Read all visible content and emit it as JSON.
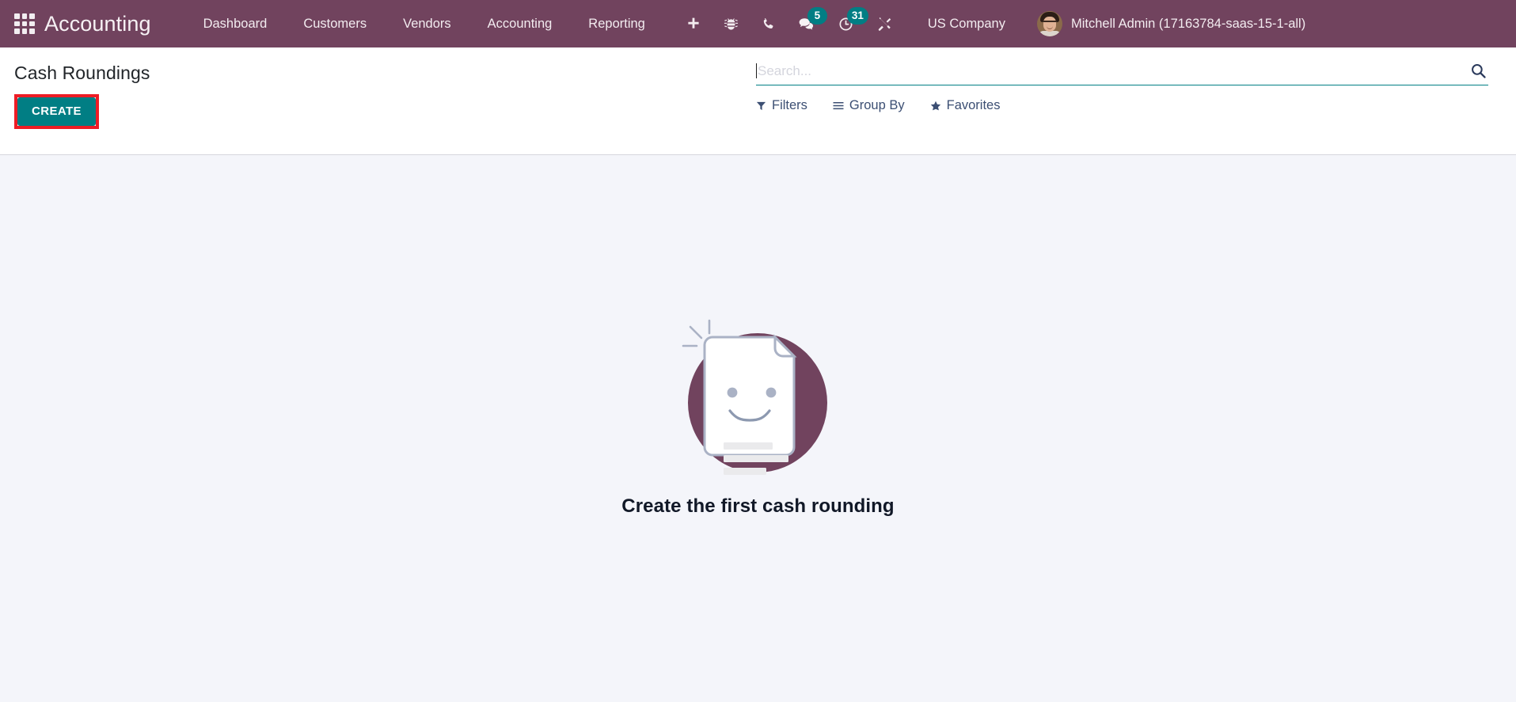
{
  "navbar": {
    "apps_icon": "apps-grid-icon",
    "brand": "Accounting",
    "menu_items": [
      {
        "label": "Dashboard"
      },
      {
        "label": "Customers"
      },
      {
        "label": "Vendors"
      },
      {
        "label": "Accounting"
      },
      {
        "label": "Reporting"
      }
    ],
    "icons": [
      {
        "name": "plus-icon",
        "badge": ""
      },
      {
        "name": "bug-icon",
        "badge": ""
      },
      {
        "name": "phone-icon",
        "badge": ""
      },
      {
        "name": "chat-icon",
        "badge": "5"
      },
      {
        "name": "activity-clock-icon",
        "badge": "31"
      },
      {
        "name": "tools-icon",
        "badge": ""
      }
    ],
    "chat_badge": "5",
    "activity_badge": "31",
    "company": "US Company",
    "user_name": "Mitchell Admin (17163784-saas-15-1-all)",
    "avatar_icon": "user-avatar"
  },
  "control_panel": {
    "title": "Cash Roundings",
    "create_label": "CREATE",
    "highlight_color": "#ee1c25",
    "accent_color": "#017e84"
  },
  "search": {
    "placeholder": "Search...",
    "value": "",
    "search_icon": "search-icon"
  },
  "filters": [
    {
      "label": "Filters",
      "icon": "filter-funnel-icon"
    },
    {
      "label": "Group By",
      "icon": "bars-icon"
    },
    {
      "label": "Favorites",
      "icon": "star-icon"
    }
  ],
  "empty_state": {
    "message": "Create the first cash rounding",
    "illustration": "smiling-document-icon",
    "circle_color": "#71435e",
    "document_color": "#ffffff"
  },
  "theme": {
    "navbar_bg": "#71435e",
    "content_bg": "#f4f5fa",
    "panel_bg": "#ffffff",
    "badge_bg": "#017e84",
    "filter_text": "#3c4f73"
  }
}
